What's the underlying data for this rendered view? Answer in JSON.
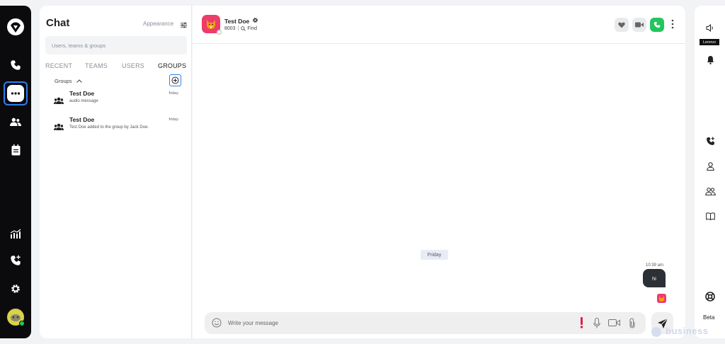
{
  "leftnav": {
    "items": [
      {
        "icon": "logo-icon"
      },
      {
        "icon": "phone-icon"
      },
      {
        "icon": "chat-icon",
        "active": true
      },
      {
        "icon": "contacts-icon"
      },
      {
        "icon": "notepad-icon"
      },
      {
        "icon": "stats-icon"
      },
      {
        "icon": "phone-add-icon"
      },
      {
        "icon": "gear-icon"
      },
      {
        "icon": "user-avatar"
      }
    ]
  },
  "chatpanel": {
    "title": "Chat",
    "appearance_label": "Appearance",
    "search_placeholder": "Users, teams & groups",
    "tabs": [
      "RECENT",
      "TEAMS",
      "USERS",
      "GROUPS"
    ],
    "active_tab": "GROUPS",
    "groups_label": "Groups",
    "conversations": [
      {
        "name": "Test Doe",
        "preview": "audio message",
        "time": "friday"
      },
      {
        "name": "Test Doe",
        "preview": "Test Doe added to the group by Jack Doe.",
        "time": "friday"
      }
    ]
  },
  "main": {
    "contact": {
      "name": "Test Doe",
      "extension": "8003",
      "find_label": "Find"
    },
    "day_separator": "Friday",
    "messages": [
      {
        "time": "10:39 am",
        "text": "hi",
        "outgoing": true
      }
    ],
    "composer_placeholder": "Write your message"
  },
  "rightrail": {
    "brand_badge": "Lenovo",
    "beta_label": "Beta",
    "watermark": "business"
  },
  "colors": {
    "accent_blue": "#2f7ef0",
    "call_green": "#22c55e",
    "avatar_pink": "#ec3c6b",
    "alert_red": "#e11d48",
    "dark_nav": "#0b0b0d"
  }
}
